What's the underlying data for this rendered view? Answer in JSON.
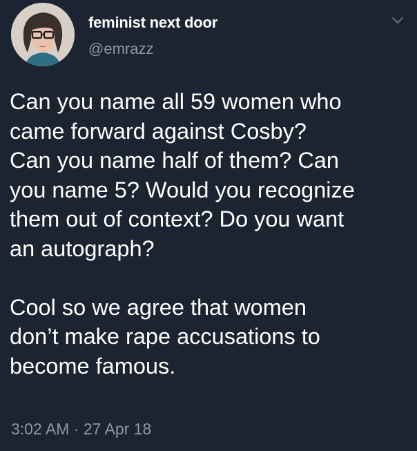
{
  "author": {
    "display_name": "feminist next door",
    "handle": "@emrazz"
  },
  "tweet": {
    "paragraph1_lines": [
      "Can you name all 59 women who",
      "came forward against Cosby?",
      "Can you name half of them? Can",
      "you name 5? Would you recognize",
      "them out of context? Do you want",
      "an autograph?"
    ],
    "paragraph2_lines": [
      "Cool so we agree that women",
      "don’t make rape accusations to",
      "become famous."
    ],
    "time": "3:02 AM",
    "separator": "·",
    "date": "27 Apr 18"
  },
  "icons": {
    "menu": "chevron-down-icon",
    "avatar": "profile-photo"
  },
  "colors": {
    "background": "#1c2431",
    "primary_text": "#ffffff",
    "secondary_text": "#8a98a8"
  }
}
